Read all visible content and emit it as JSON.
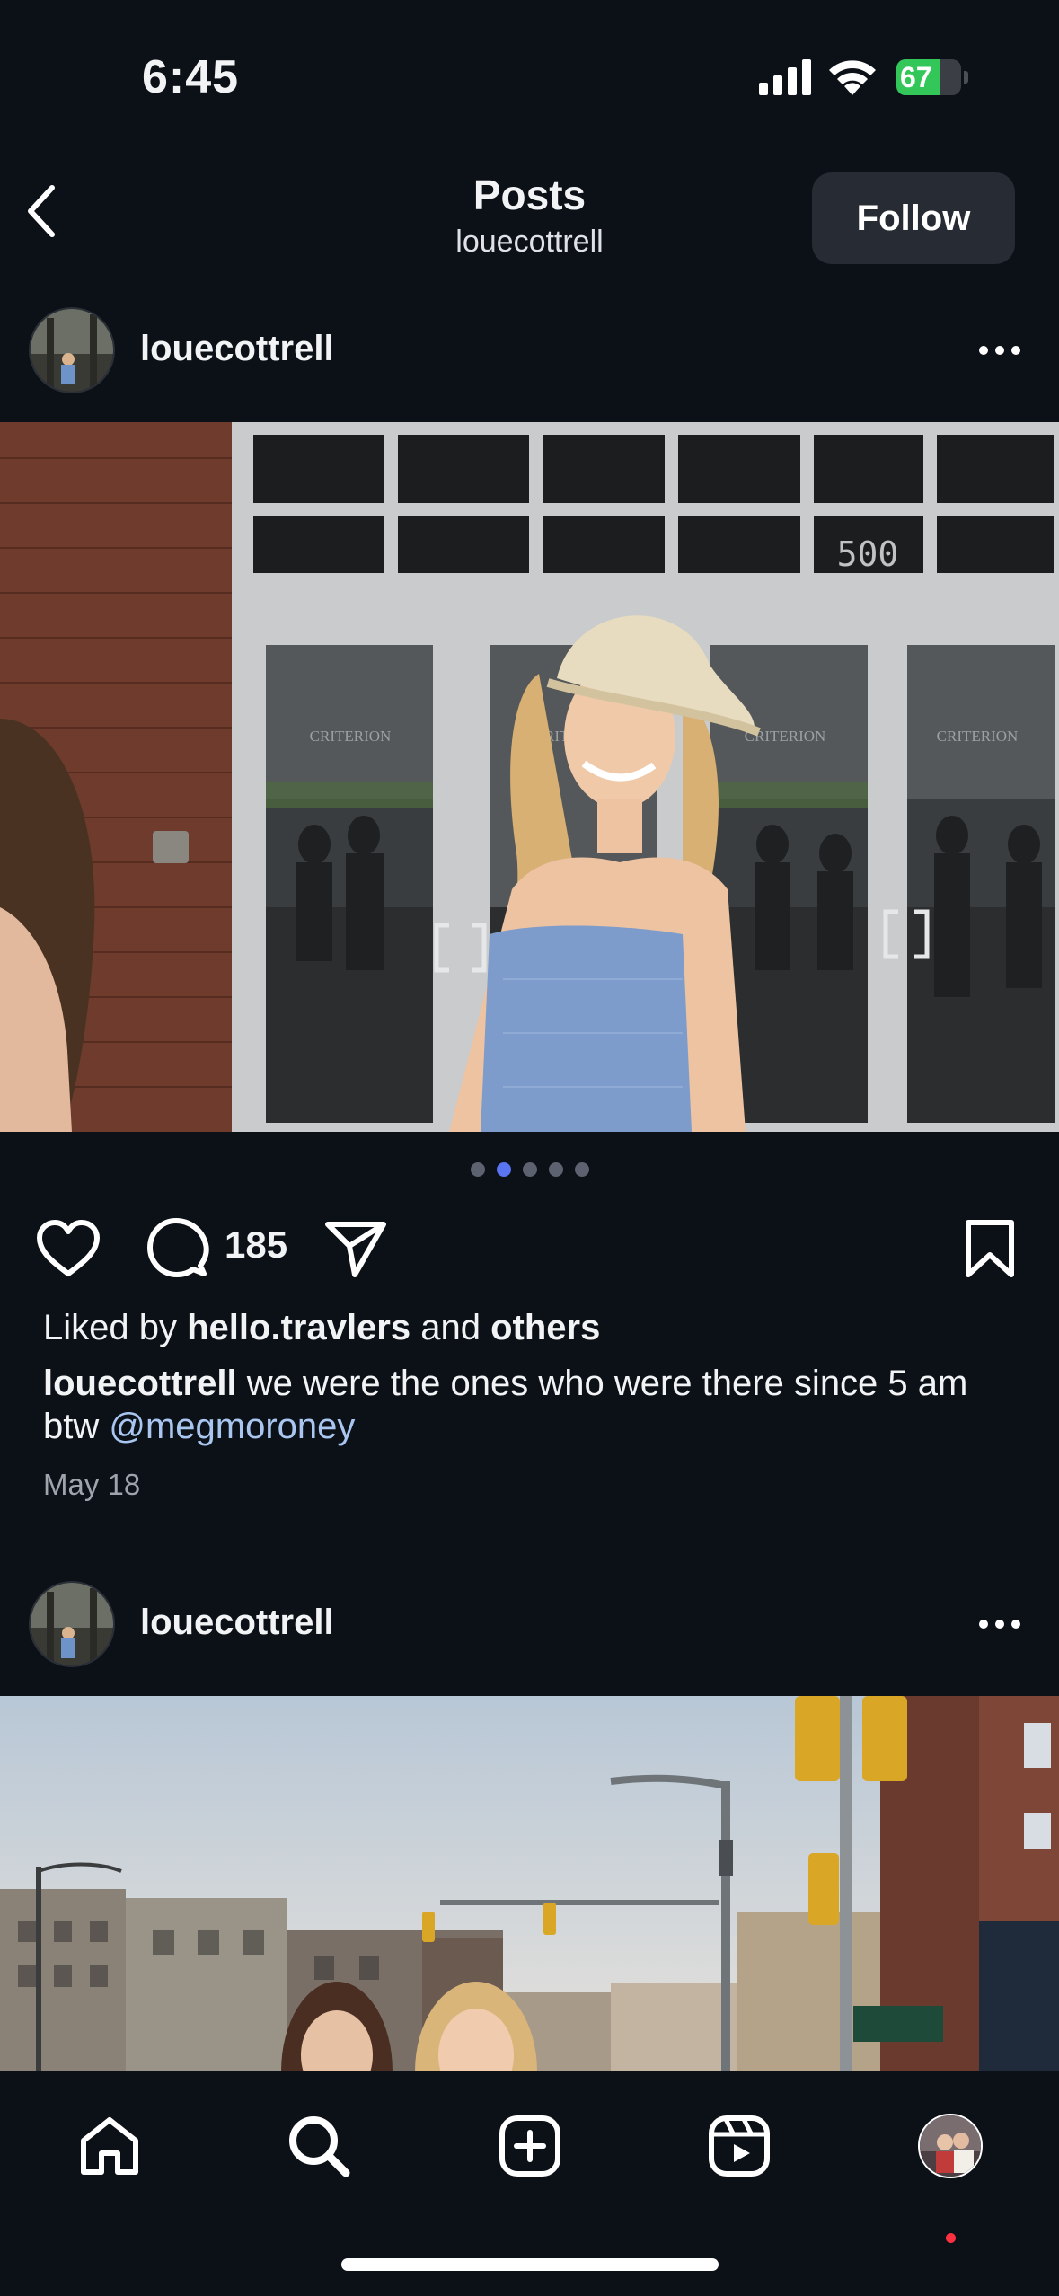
{
  "status_bar": {
    "time": "6:45",
    "battery_percent": 67,
    "battery_label": "67"
  },
  "header": {
    "title": "Posts",
    "username": "louecottrell",
    "follow_label": "Follow"
  },
  "posts": [
    {
      "username": "louecottrell",
      "image_slide_count": 5,
      "active_slide": 2,
      "comment_count": "185",
      "liked_by_prefix": "Liked by ",
      "liked_by_user": "hello.travlers",
      "liked_by_join": " and ",
      "liked_by_others": "others",
      "caption_user": "louecottrell",
      "caption_text": " we were the ones who were there since 5 am btw ",
      "caption_mention": "@megmoroney",
      "date": "May 18",
      "photo_signs": {
        "door_brand": "CRITERION",
        "building_number": "500"
      }
    },
    {
      "username": "louecottrell"
    }
  ],
  "nav": {
    "items": [
      "home-icon",
      "search-icon",
      "create-icon",
      "reels-icon",
      "profile-avatar"
    ]
  },
  "colors": {
    "background": "#0c1017",
    "accent": "#5a74f2",
    "mention": "#a9c6f0"
  }
}
